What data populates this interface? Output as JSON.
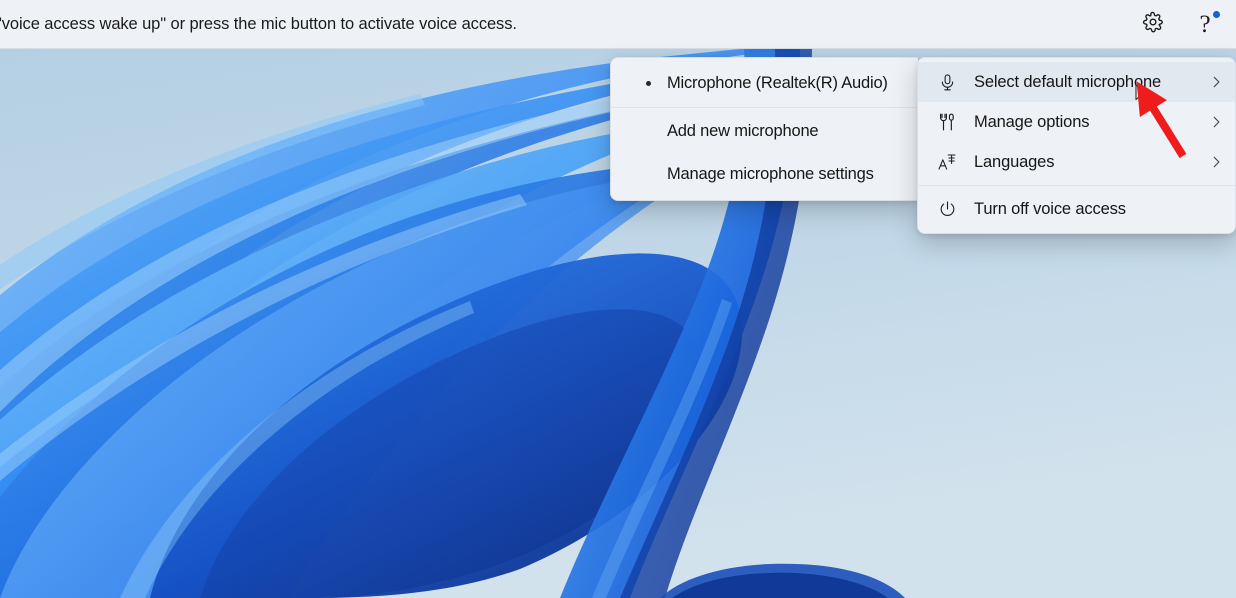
{
  "topbar": {
    "message": "\" \"voice access wake up\" or press the mic button to activate voice access.",
    "message_visible": "\"voice access wake up\" or press the mic button to activate voice access.",
    "settings_icon": "gear-icon",
    "help_icon": "question-mark-icon",
    "help_badge": "notification-dot",
    "background_color": "#eef2f7",
    "text_color": "#1b1b1b"
  },
  "main_menu": {
    "background_color": "#eef2f7",
    "highlight_color": "#e2e8f0",
    "items": [
      {
        "label": "Select default microphone",
        "icon": "microphone-icon",
        "submenu_indicator": "›",
        "highlighted": true
      },
      {
        "label": "Manage options",
        "icon": "tools-icon",
        "submenu_indicator": "›",
        "highlighted": false
      },
      {
        "label": "Languages",
        "icon": "language-icon",
        "submenu_indicator": "›",
        "highlighted": false
      },
      {
        "label": "Turn off voice access",
        "icon": "power-icon",
        "submenu_indicator": "",
        "highlighted": false
      }
    ]
  },
  "microphone_submenu": {
    "background_color": "#eef2f7",
    "items": [
      {
        "label": "Microphone (Realtek(R) Audio)",
        "selected": true
      },
      {
        "label": "Add new microphone",
        "selected": false
      },
      {
        "label": "Manage microphone settings",
        "selected": false
      }
    ]
  },
  "annotation": {
    "arrow_color": "#ee1c1c",
    "arrow_tip": "1138,88",
    "arrow_tail": "1183,156"
  },
  "wallpaper": {
    "name": "windows-11-bloom",
    "sky_top": "#b7d1e4",
    "sky_bottom": "#cfe0ec",
    "petal_light": "#6cb6f5",
    "petal_mid": "#2a7ff0",
    "petal_dark": "#1148b8",
    "petal_deep": "#0b2f8e"
  }
}
